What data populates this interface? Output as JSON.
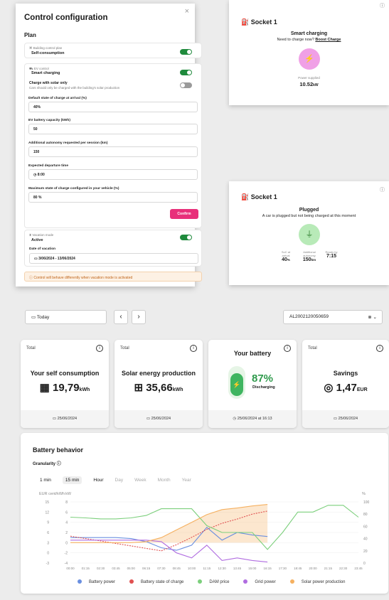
{
  "config": {
    "title": "Control configuration",
    "close": "×",
    "plan_heading": "Plan",
    "building_plan_label": "Building control plan",
    "building_plan_value": "Self-consumption",
    "ev_control_label": "EV control",
    "ev_control_value": "Smart charging",
    "solar_only_label": "Charge with solar only",
    "solar_only_desc": "Cars should only be charged with the building's solar production",
    "fields": [
      {
        "label": "Default state of charge at arrival (%)",
        "value": "40%"
      },
      {
        "label": "EV battery capacity (kWh)",
        "value": "50"
      },
      {
        "label": "Additional autonomy requested per session (km)",
        "value": "150"
      },
      {
        "label": "Expected departure time",
        "value": "8:00"
      },
      {
        "label": "Maximum state of charge configured in your vehicle (%)",
        "value": "80 %"
      }
    ],
    "confirm": "Confirm",
    "vacation_label": "Vacation mode",
    "vacation_value": "Active",
    "vacation_date_label": "Date of vacation",
    "vacation_date_value": "3/06/2024 - 13/06/2024",
    "warning": "Control will behave differently when vacation mode is activated",
    "toggle_on": "ON",
    "toggle_off": "OFF"
  },
  "socket_top": {
    "title": "Socket 1",
    "status": "Smart charging",
    "prompt": "Need to charge now?",
    "boost": "Boost Charge",
    "power_label": "Power supplied",
    "power_value": "10.52",
    "power_unit": "kW",
    "accent": "#f0a0e6"
  },
  "socket_bottom": {
    "title": "Socket 1",
    "status": "Plugged",
    "desc": "A car is plugged but not being charged at this moment",
    "soc_label": "SoC at arrival",
    "soc_value": "40",
    "soc_unit": "%",
    "auto_label": "Additional autonomy",
    "auto_value": "150",
    "auto_unit": "km",
    "ready_label": "Ready by",
    "ready_value": "7:15",
    "accent": "#b8eab8"
  },
  "toolbar": {
    "date": "Today",
    "prev": "‹",
    "next": "›",
    "device": "AL2002120050659"
  },
  "stats": [
    {
      "total": "Total",
      "title": "Your self consumption",
      "value": "19,79",
      "unit": "kWh",
      "date": "25/06/2024",
      "icon": "building-icon"
    },
    {
      "total": "Total",
      "title": "Solar energy production",
      "value": "35,66",
      "unit": "kWh",
      "date": "25/06/2024",
      "icon": "solar-panel-icon"
    },
    {
      "total": "",
      "title": "Your battery",
      "value": "87%",
      "unit": "Discharging",
      "date": "25/06/2024 at 16:13",
      "icon": "battery-icon"
    },
    {
      "total": "Total",
      "title": "Savings",
      "value": "1,47",
      "unit": "EUR",
      "date": "25/06/2024",
      "icon": "coins-icon"
    }
  ],
  "chart_card": {
    "title": "Battery behavior",
    "granularity_label": "Granularity",
    "granularities": [
      "1 min",
      "15 min",
      "Hour",
      "Day",
      "Week",
      "Month",
      "Year"
    ],
    "granularity_selected": "15 min"
  },
  "chart_data": {
    "type": "line",
    "left_axis_title": "EUR cent/kWh",
    "left2_axis_title": "kW",
    "right_axis_title": "%",
    "price_ticks": [
      15,
      12,
      9,
      6,
      3,
      0,
      -3
    ],
    "kw_ticks": [
      8,
      6,
      4,
      2,
      0,
      -2,
      -4
    ],
    "pct_ticks": [
      100,
      80,
      60,
      40,
      20,
      0
    ],
    "x": [
      "00:00",
      "01:15",
      "02:30",
      "03:45",
      "05:00",
      "06:15",
      "07:30",
      "08:45",
      "10:00",
      "11:15",
      "12:30",
      "13:45",
      "15:00",
      "16:15",
      "17:30",
      "18:45",
      "20:00",
      "21:15",
      "22:30",
      "23:45"
    ],
    "series": [
      {
        "name": "Battery power",
        "color": "#6a8fe0",
        "axis": "kw",
        "values": [
          1.0,
          1.0,
          1.0,
          1.0,
          0.8,
          0.2,
          -1.0,
          -1.5,
          -0.5,
          3.0,
          0.5,
          2.0,
          1.5,
          1.2,
          null,
          null,
          null,
          null,
          null,
          null
        ]
      },
      {
        "name": "Battery state of charge",
        "color": "#e05050",
        "axis": "pct",
        "values": [
          44,
          40,
          36,
          32,
          28,
          24,
          20,
          30,
          42,
          55,
          65,
          72,
          80,
          85,
          null,
          null,
          null,
          null,
          null,
          null
        ]
      },
      {
        "name": "DAM price",
        "color": "#7ccf7c",
        "axis": "price",
        "values": [
          10.5,
          10.3,
          10.0,
          10.0,
          10.3,
          11.0,
          13.0,
          13.0,
          13.0,
          8.0,
          6.0,
          6.0,
          6.0,
          1.0,
          6.0,
          12.0,
          12.0,
          14.0,
          14.0,
          10.5
        ]
      },
      {
        "name": "Grid power",
        "color": "#b06ce0",
        "axis": "kw",
        "values": [
          0.5,
          0.5,
          0.5,
          0.5,
          0.5,
          0.5,
          0.2,
          -2.0,
          -3.0,
          -0.5,
          -3.5,
          -3.0,
          -3.5,
          -3.8,
          null,
          null,
          null,
          null,
          null,
          null
        ]
      },
      {
        "name": "Solar power production",
        "color": "#f5b060",
        "axis": "kw",
        "values": [
          0,
          0,
          0,
          0,
          0,
          0.2,
          1.0,
          2.5,
          4.0,
          5.5,
          6.5,
          6.8,
          7.2,
          7.5,
          null,
          null,
          null,
          null,
          null,
          null
        ]
      }
    ],
    "ranges": {
      "price": [
        -3,
        15
      ],
      "kw": [
        -4,
        8
      ],
      "pct": [
        0,
        100
      ]
    }
  }
}
